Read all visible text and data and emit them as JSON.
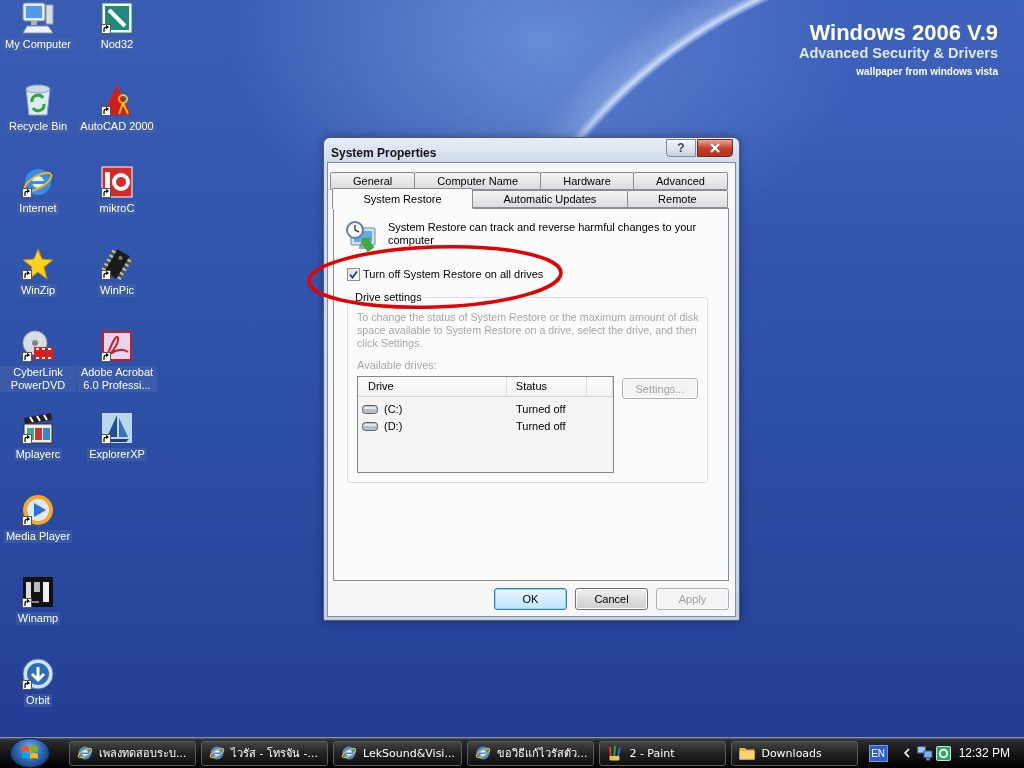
{
  "wallpaper": {
    "title": "Windows 2006 V.9",
    "subtitle": "Advanced Security & Drivers",
    "credit": "wallpaper from windows vista"
  },
  "desktop_icons": [
    {
      "label": "My Computer",
      "shortcut": false
    },
    {
      "label": "Recycle Bin",
      "shortcut": false
    },
    {
      "label": "Internet",
      "shortcut": true
    },
    {
      "label": "WinZip",
      "shortcut": true
    },
    {
      "label": "CyberLink PowerDVD",
      "shortcut": true
    },
    {
      "label": "Mplayerc",
      "shortcut": true
    },
    {
      "label": "Media Player",
      "shortcut": true
    },
    {
      "label": "Winamp",
      "shortcut": true
    },
    {
      "label": "Orbit",
      "shortcut": true
    },
    {
      "label": "Nod32",
      "shortcut": true
    },
    {
      "label": "AutoCAD 2000",
      "shortcut": true
    },
    {
      "label": "mikroC",
      "shortcut": true
    },
    {
      "label": "WinPic",
      "shortcut": true
    },
    {
      "label": "Adobe Acrobat 6.0 Professi...",
      "shortcut": true
    },
    {
      "label": "ExplorerXP",
      "shortcut": true
    }
  ],
  "window": {
    "title": "System Properties",
    "help_button": "?"
  },
  "tab_rows": [
    {
      "tabs": [
        {
          "label": "General",
          "selected": false
        },
        {
          "label": "Computer Name",
          "selected": false
        },
        {
          "label": "Hardware",
          "selected": false
        },
        {
          "label": "Advanced",
          "selected": false
        }
      ]
    },
    {
      "tabs": [
        {
          "label": "System Restore",
          "selected": true
        },
        {
          "label": "Automatic Updates",
          "selected": false
        },
        {
          "label": "Remote",
          "selected": false
        }
      ]
    }
  ],
  "panel": {
    "intro": "System Restore can track and reverse harmful changes to your computer",
    "checkbox": {
      "label": "Turn off System Restore on all drives",
      "checked": true
    },
    "drive_settings": {
      "title": "Drive settings",
      "disabled": true,
      "description": "To change the status of System Restore or the maximum amount of disk space available to System Restore on a drive, select the drive, and then click Settings.",
      "list_label": "Available drives:",
      "columns": [
        "Drive",
        "Status"
      ],
      "drives": [
        {
          "name": "(C:)",
          "status": "Turned off"
        },
        {
          "name": "(D:)",
          "status": "Turned off"
        }
      ],
      "settings_button": "Settings..."
    }
  },
  "buttons": [
    {
      "label": "OK",
      "default": true,
      "disabled": false
    },
    {
      "label": "Cancel",
      "default": false,
      "disabled": false
    },
    {
      "label": "Apply",
      "default": false,
      "disabled": true
    }
  ],
  "taskbar": {
    "tasks": [
      {
        "label": "เพลงทดสอบระบ..."
      },
      {
        "label": "ไวรัส - โทรจัน -..."
      },
      {
        "label": "LekSound&Visi..."
      },
      {
        "label": "ขอวิธีแก้ไวรัสตัว..."
      },
      {
        "label": "2 - Paint"
      },
      {
        "label": "Downloads"
      }
    ],
    "language": "EN",
    "clock": "12:32 PM"
  }
}
